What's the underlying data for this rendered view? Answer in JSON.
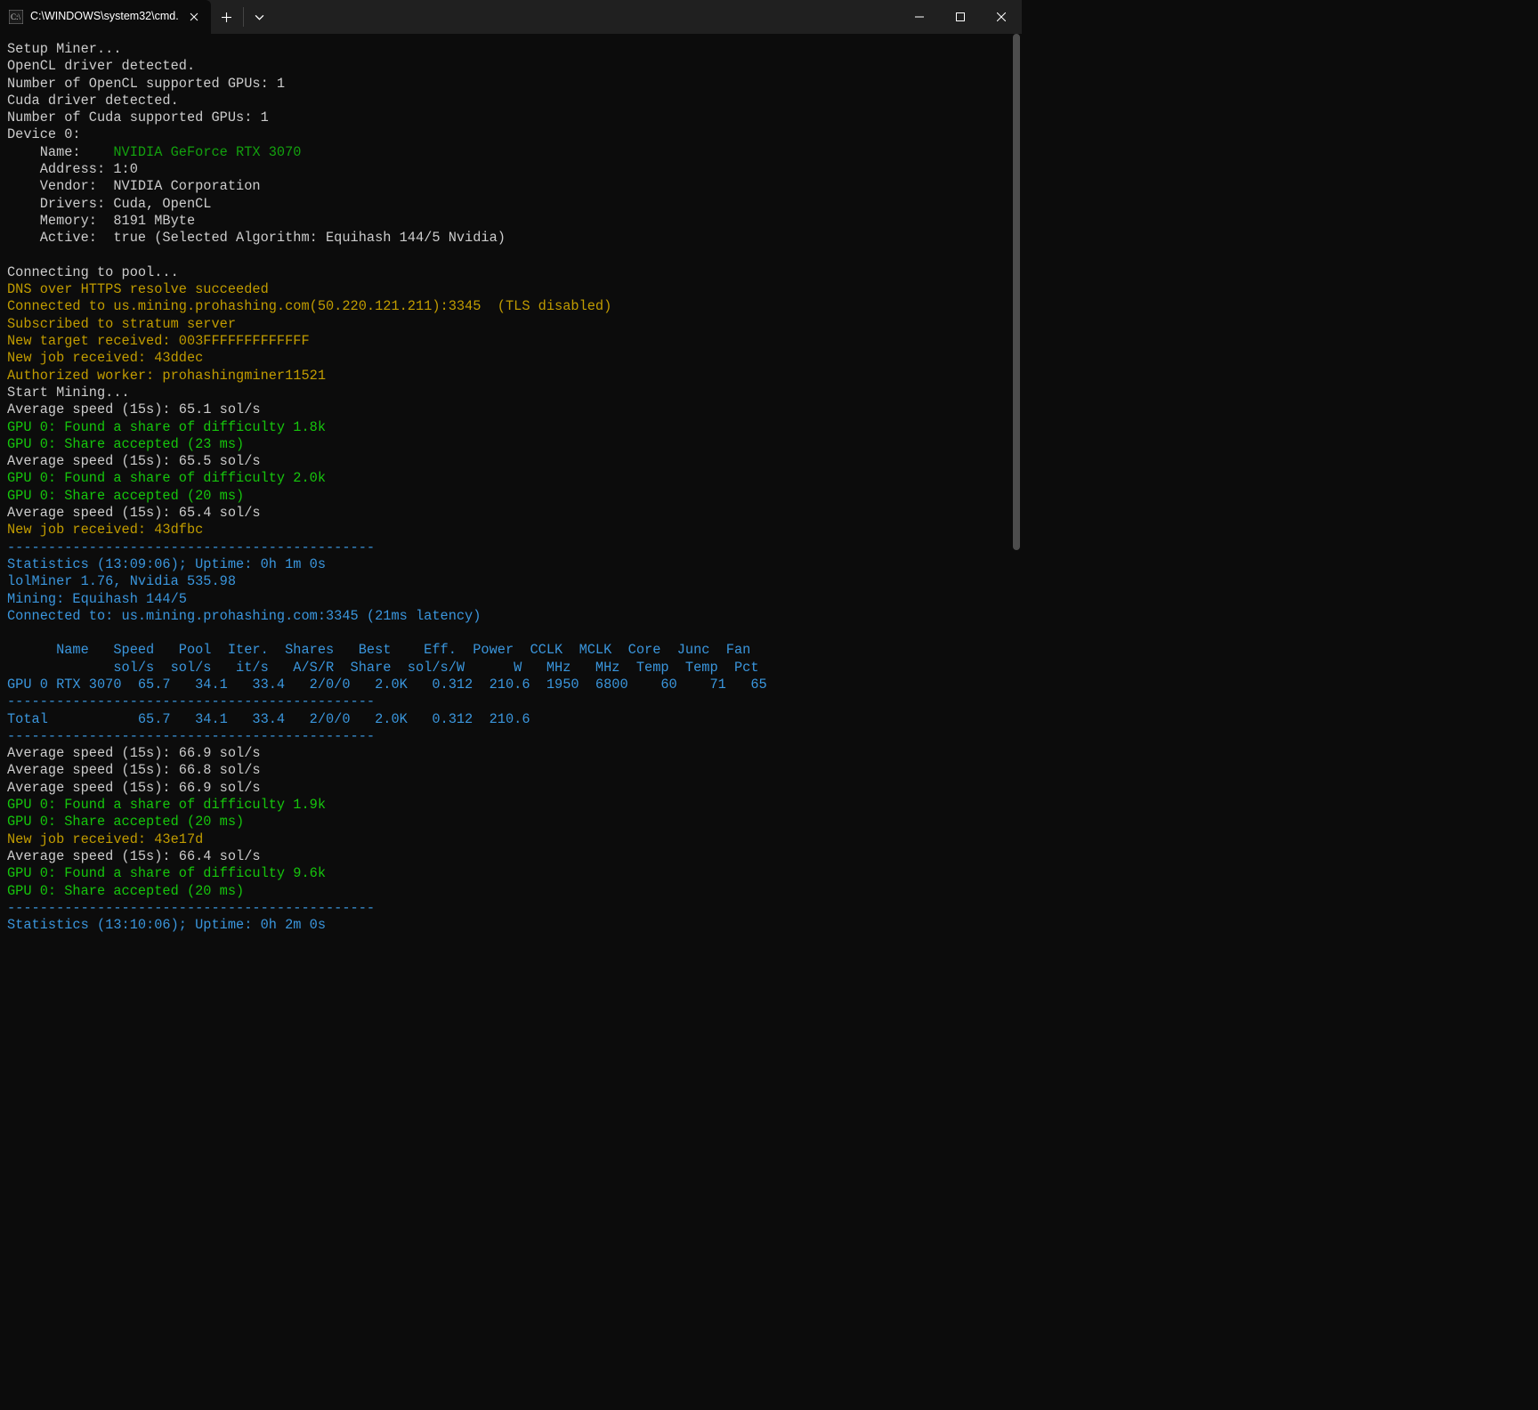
{
  "titlebar": {
    "tab_title": "C:\\WINDOWS\\system32\\cmd."
  },
  "lines": [
    {
      "cls": "white",
      "text": "Setup Miner..."
    },
    {
      "cls": "white",
      "text": "OpenCL driver detected."
    },
    {
      "cls": "white",
      "text": "Number of OpenCL supported GPUs: 1"
    },
    {
      "cls": "white",
      "text": "Cuda driver detected."
    },
    {
      "cls": "white",
      "text": "Number of Cuda supported GPUs: 1"
    },
    {
      "cls": "white",
      "text": "Device 0:"
    },
    {
      "spans": [
        {
          "cls": "white",
          "text": "    Name:    "
        },
        {
          "cls": "green",
          "text": "NVIDIA GeForce RTX 3070"
        }
      ]
    },
    {
      "cls": "white",
      "text": "    Address: 1:0"
    },
    {
      "cls": "white",
      "text": "    Vendor:  NVIDIA Corporation"
    },
    {
      "cls": "white",
      "text": "    Drivers: Cuda, OpenCL"
    },
    {
      "cls": "white",
      "text": "    Memory:  8191 MByte"
    },
    {
      "cls": "white",
      "text": "    Active:  true (Selected Algorithm: Equihash 144/5 Nvidia)"
    },
    {
      "cls": "white",
      "text": ""
    },
    {
      "cls": "white",
      "text": "Connecting to pool..."
    },
    {
      "cls": "yellow",
      "text": "DNS over HTTPS resolve succeeded"
    },
    {
      "cls": "yellow",
      "text": "Connected to us.mining.prohashing.com(50.220.121.211):3345  (TLS disabled)"
    },
    {
      "cls": "yellow",
      "text": "Subscribed to stratum server"
    },
    {
      "cls": "yellow",
      "text": "New target received: 003FFFFFFFFFFFFF"
    },
    {
      "cls": "yellow",
      "text": "New job received: 43ddec"
    },
    {
      "cls": "yellow",
      "text": "Authorized worker: prohashingminer11521"
    },
    {
      "cls": "white",
      "text": "Start Mining..."
    },
    {
      "cls": "white",
      "text": "Average speed (15s): 65.1 sol/s"
    },
    {
      "cls": "bgreen",
      "text": "GPU 0: Found a share of difficulty 1.8k"
    },
    {
      "cls": "bgreen",
      "text": "GPU 0: Share accepted (23 ms)"
    },
    {
      "cls": "white",
      "text": "Average speed (15s): 65.5 sol/s"
    },
    {
      "cls": "bgreen",
      "text": "GPU 0: Found a share of difficulty 2.0k"
    },
    {
      "cls": "bgreen",
      "text": "GPU 0: Share accepted (20 ms)"
    },
    {
      "cls": "white",
      "text": "Average speed (15s): 65.4 sol/s"
    },
    {
      "cls": "yellow",
      "text": "New job received: 43dfbc"
    },
    {
      "cls": "cyan",
      "text": "---------------------------------------------"
    },
    {
      "cls": "cyan",
      "text": "Statistics (13:09:06); Uptime: 0h 1m 0s"
    },
    {
      "cls": "cyan",
      "text": "lolMiner 1.76, Nvidia 535.98"
    },
    {
      "cls": "cyan",
      "text": "Mining: Equihash 144/5"
    },
    {
      "cls": "cyan",
      "text": "Connected to: us.mining.prohashing.com:3345 (21ms latency)"
    },
    {
      "cls": "white",
      "text": ""
    },
    {
      "cls": "cyan",
      "text": "      Name   Speed   Pool  Iter.  Shares   Best    Eff.  Power  CCLK  MCLK  Core  Junc  Fan"
    },
    {
      "cls": "cyan",
      "text": "             sol/s  sol/s   it/s   A/S/R  Share  sol/s/W      W   MHz   MHz  Temp  Temp  Pct"
    },
    {
      "cls": "cyan",
      "text": "GPU 0 RTX 3070  65.7   34.1   33.4   2/0/0   2.0K   0.312  210.6  1950  6800    60    71   65"
    },
    {
      "cls": "cyan",
      "text": "---------------------------------------------"
    },
    {
      "cls": "cyan",
      "text": "Total           65.7   34.1   33.4   2/0/0   2.0K   0.312  210.6"
    },
    {
      "cls": "cyan",
      "text": "---------------------------------------------"
    },
    {
      "cls": "white",
      "text": "Average speed (15s): 66.9 sol/s"
    },
    {
      "cls": "white",
      "text": "Average speed (15s): 66.8 sol/s"
    },
    {
      "cls": "white",
      "text": "Average speed (15s): 66.9 sol/s"
    },
    {
      "cls": "bgreen",
      "text": "GPU 0: Found a share of difficulty 1.9k"
    },
    {
      "cls": "bgreen",
      "text": "GPU 0: Share accepted (20 ms)"
    },
    {
      "cls": "yellow",
      "text": "New job received: 43e17d"
    },
    {
      "cls": "white",
      "text": "Average speed (15s): 66.4 sol/s"
    },
    {
      "cls": "bgreen",
      "text": "GPU 0: Found a share of difficulty 9.6k"
    },
    {
      "cls": "bgreen",
      "text": "GPU 0: Share accepted (20 ms)"
    },
    {
      "cls": "cyan",
      "text": "---------------------------------------------"
    },
    {
      "cls": "cyan",
      "text": "Statistics (13:10:06); Uptime: 0h 2m 0s"
    }
  ],
  "stats_table": {
    "headers_row1": [
      "Name",
      "Speed",
      "Pool",
      "Iter.",
      "Shares",
      "Best",
      "Eff.",
      "Power",
      "CCLK",
      "MCLK",
      "Core",
      "Junc",
      "Fan"
    ],
    "headers_row2": [
      "",
      "sol/s",
      "sol/s",
      "it/s",
      "A/S/R",
      "Share",
      "sol/s/W",
      "W",
      "MHz",
      "MHz",
      "Temp",
      "Temp",
      "Pct"
    ],
    "rows": [
      {
        "name": "GPU 0 RTX 3070",
        "speed": "65.7",
        "pool": "34.1",
        "iter": "33.4",
        "shares": "2/0/0",
        "best": "2.0K",
        "eff": "0.312",
        "power": "210.6",
        "cclk": "1950",
        "mclk": "6800",
        "core": "60",
        "junc": "71",
        "fan": "65"
      }
    ],
    "total": {
      "name": "Total",
      "speed": "65.7",
      "pool": "34.1",
      "iter": "33.4",
      "shares": "2/0/0",
      "best": "2.0K",
      "eff": "0.312",
      "power": "210.6"
    }
  }
}
